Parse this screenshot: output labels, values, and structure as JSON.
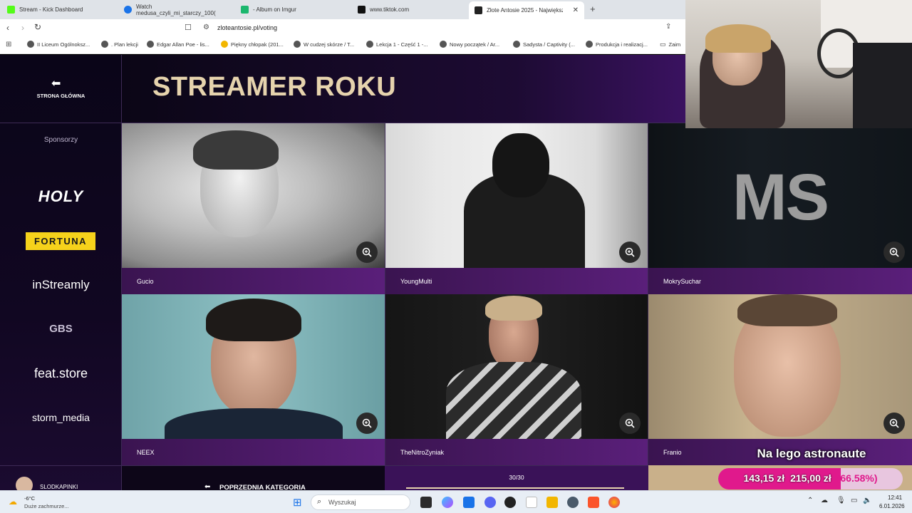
{
  "browser": {
    "tabs": [
      {
        "label": "Stream - Kick Dashboard",
        "color": "#53fc18"
      },
      {
        "label": "Watch medusa_czyli_mi_starczy_100(",
        "color": "#1a73e8"
      },
      {
        "label": "- Album on Imgur",
        "color": "#1bb76e"
      },
      {
        "label": "www.tiktok.com",
        "color": "#111111"
      },
      {
        "label": "Złote Antosie 2025 - Największy",
        "color": "#222222"
      }
    ],
    "new_tab": "+",
    "url": "zloteantosie.pl/voting",
    "bookmarks": [
      "II Liceum Ogólnoksz...",
      ". Plan lekcji",
      "Edgar Allan Poe - lis...",
      "Piękny chłopak (201...",
      "W cudzej skórze / T...",
      "Lekcja 1 - Część 1 -...",
      "Nowy początek / Ar...",
      "Sadysta / Captivity (...",
      "Produkcja i realizacj...",
      "Zaim"
    ]
  },
  "site": {
    "home_label": "STRONA GŁÓWNA",
    "category_title": "STREAMER ROKU",
    "sponsors_heading": "Sponsorzy",
    "sponsors": [
      "HOLY",
      "FORTUNA",
      "inStreamly",
      "GBS",
      "feat.store",
      "storm_media"
    ],
    "candidates": [
      {
        "name": "Gucio"
      },
      {
        "name": "YoungMulti"
      },
      {
        "name": "MokrySuchar",
        "initials": "MS"
      },
      {
        "name": "NEEX"
      },
      {
        "name": "TheNitroZyniak"
      },
      {
        "name": "Franio"
      }
    ],
    "user_name": "SLODKAPINKI",
    "prev_category": "POPRZEDNIA KATEGORIA",
    "progress": "30/30",
    "progress_fraction": 1.0
  },
  "overlay": {
    "goal_title": "Na lego astronaute",
    "goal_current": "143,15 zł",
    "goal_target": "215,00 zł",
    "goal_percent": "(66.58%)",
    "goal_fraction": 0.6658
  },
  "taskbar": {
    "weather_temp": "-6°C",
    "weather_desc": "Duże zachmurze...",
    "search_placeholder": "Wyszukaj",
    "time": "12:41",
    "date": "6.01.2026"
  },
  "colors": {
    "title_gold": "#e6d3ad",
    "accent_purple": "#5a1f7a",
    "goal_pink": "#e0198c",
    "fortuna_yellow": "#f6d21b"
  }
}
